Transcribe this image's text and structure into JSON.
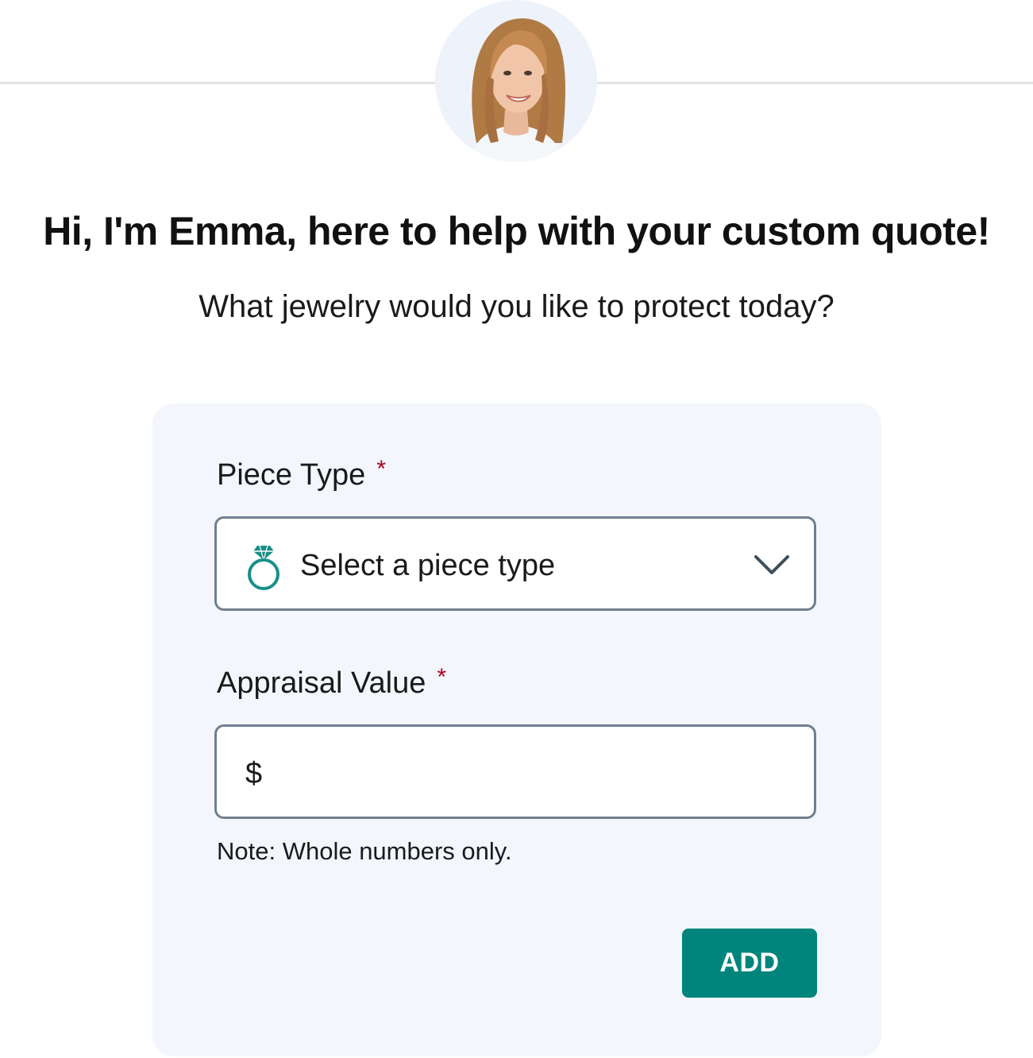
{
  "header": {
    "headline": "Hi, I'm Emma, here to help with your custom quote!",
    "subheadline": "What jewelry would you like to protect today?"
  },
  "avatar": {
    "name": "Emma",
    "icon": "person-photo"
  },
  "form": {
    "piece_type": {
      "label": "Piece Type",
      "required_marker": "*",
      "placeholder": "Select a piece type",
      "icon": "ring-icon",
      "dropdown_icon": "chevron-down-icon"
    },
    "appraisal_value": {
      "label": "Appraisal Value",
      "required_marker": "*",
      "prefix": "$",
      "value": "",
      "note": "Note: Whole numbers only."
    },
    "add_button_label": "ADD"
  },
  "colors": {
    "accent": "#00857c",
    "required": "#b00020",
    "card_background": "#f3f6fd",
    "input_border": "#6f7f8f"
  }
}
